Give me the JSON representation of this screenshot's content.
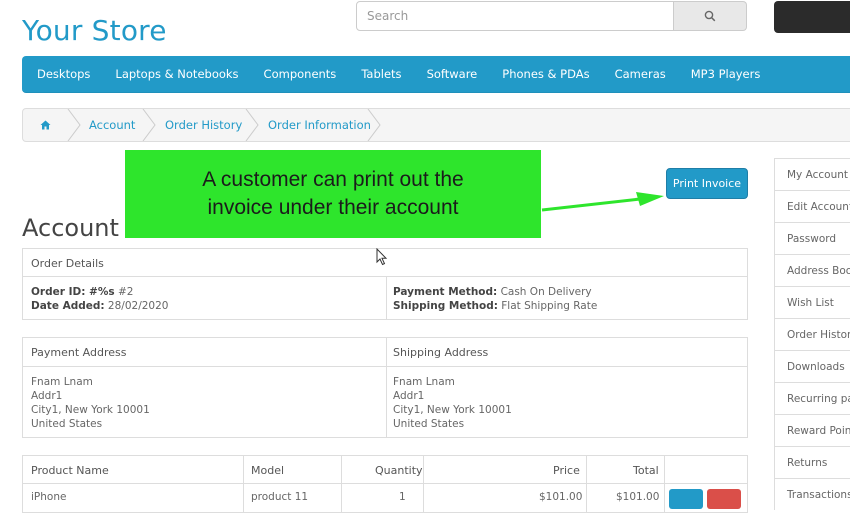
{
  "store": {
    "name": "Your Store"
  },
  "search": {
    "placeholder": "Search"
  },
  "menu": {
    "items": [
      "Desktops",
      "Laptops & Notebooks",
      "Components",
      "Tablets",
      "Software",
      "Phones & PDAs",
      "Cameras",
      "MP3 Players"
    ]
  },
  "breadcrumb": {
    "items": [
      "Account",
      "Order History",
      "Order Information"
    ]
  },
  "page": {
    "title": "Account",
    "print_label": "Print Invoice"
  },
  "annotation": {
    "line1": "A customer can print out the",
    "line2": "invoice under their account"
  },
  "order_details": {
    "header": "Order Details",
    "order_id_label": "Order ID: #%s",
    "order_id_value": " #2",
    "date_label": "Date Added:",
    "date_value": " 28/02/2020",
    "payment_label": "Payment Method:",
    "payment_value": " Cash On Delivery",
    "shipping_label": "Shipping Method:",
    "shipping_value": " Flat Shipping Rate"
  },
  "addresses": {
    "payment_header": "Payment Address",
    "shipping_header": "Shipping Address",
    "payment_lines": [
      "Fnam Lnam",
      "Addr1",
      "City1, New York 10001",
      "United States"
    ],
    "shipping_lines": [
      "Fnam Lnam",
      "Addr1",
      "City1, New York 10001",
      "United States"
    ]
  },
  "products": {
    "headers": {
      "name": "Product Name",
      "model": "Model",
      "quantity": "Quantity",
      "price": "Price",
      "total": "Total"
    },
    "rows": [
      {
        "name": "iPhone",
        "model": "product 11",
        "quantity": "1",
        "price": "$101.00",
        "total": "$101.00"
      }
    ]
  },
  "sidebar": {
    "items": [
      "My Account",
      "Edit Account",
      "Password",
      "Address Book",
      "Wish List",
      "Order History",
      "Downloads",
      "Recurring payments",
      "Reward Points",
      "Returns",
      "Transactions"
    ]
  },
  "colors": {
    "brand": "#229ac8",
    "annotation": "#2ee52c",
    "danger": "#da4f49"
  }
}
